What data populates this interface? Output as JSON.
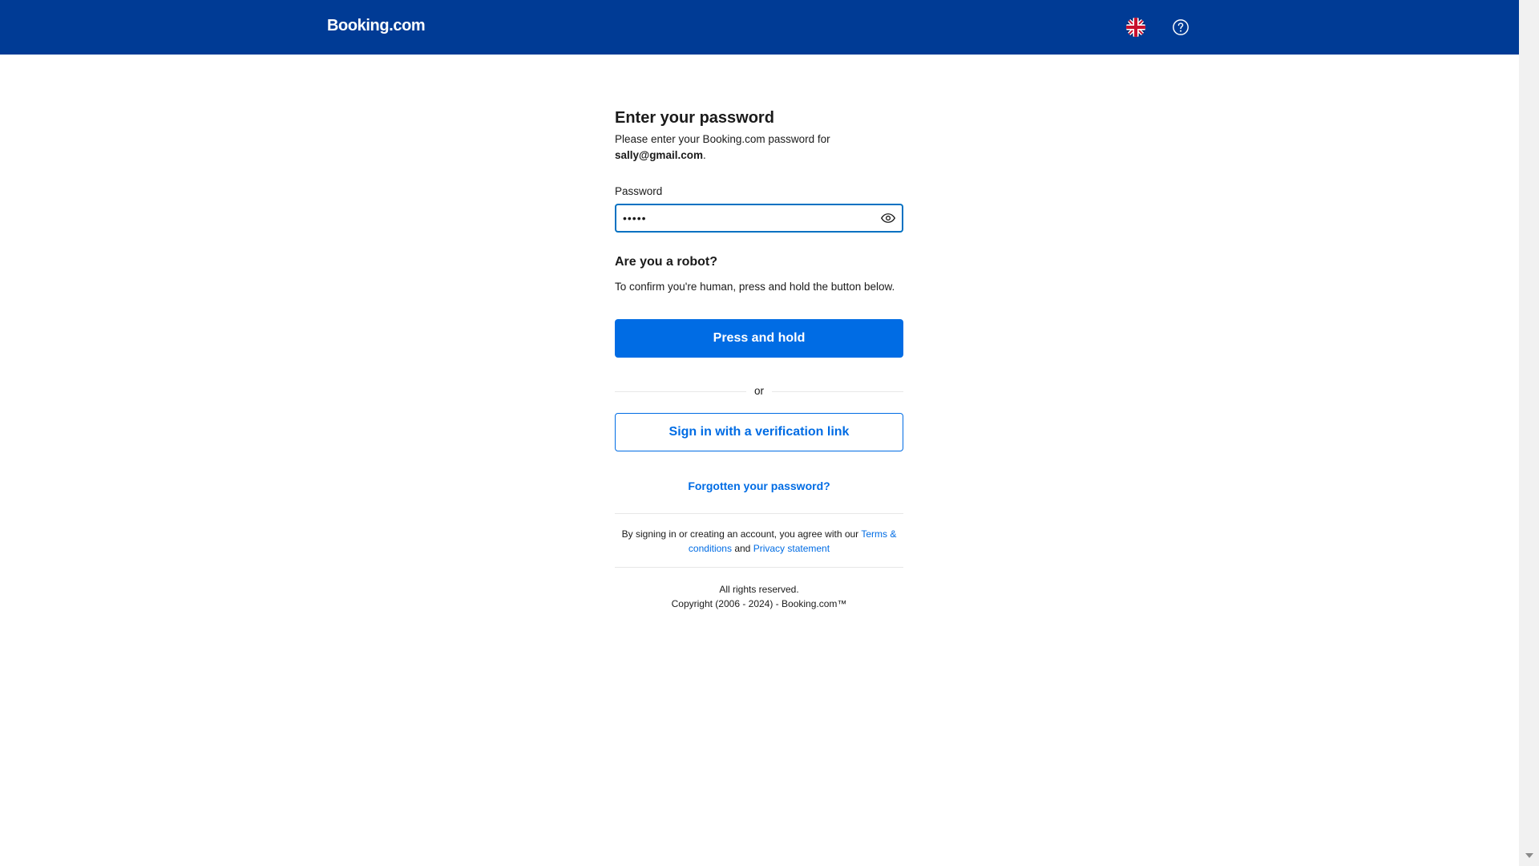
{
  "header": {
    "logo": "Booking.com",
    "language_icon": "uk-flag-icon",
    "help_icon": "question-circle-icon"
  },
  "main": {
    "title": "Enter your password",
    "subtitle_prefix": "Please enter your Booking.com password for",
    "email": "sally@gmail.com",
    "subtitle_suffix": ".",
    "password_label": "Password",
    "password_value": "•••••",
    "show_password_icon": "eye-icon",
    "robot_title": "Are you a robot?",
    "robot_text": "To confirm you're human, press and hold the button below.",
    "hold_button": "Press and hold",
    "divider_text": "or",
    "verification_link_button": "Sign in with a verification link",
    "forgot_link": "Forgotten your password?"
  },
  "legal": {
    "prefix": "By signing in or creating an account, you agree with our",
    "terms_link": "Terms & conditions",
    "and": "and",
    "privacy_link": "Privacy statement"
  },
  "footer": {
    "rights": "All rights reserved.",
    "copyright": "Copyright (2006 - 2024) - Booking.com™"
  },
  "colors": {
    "header_bg": "#003b95",
    "primary": "#006ce4",
    "focus_border": "#0071c2"
  }
}
